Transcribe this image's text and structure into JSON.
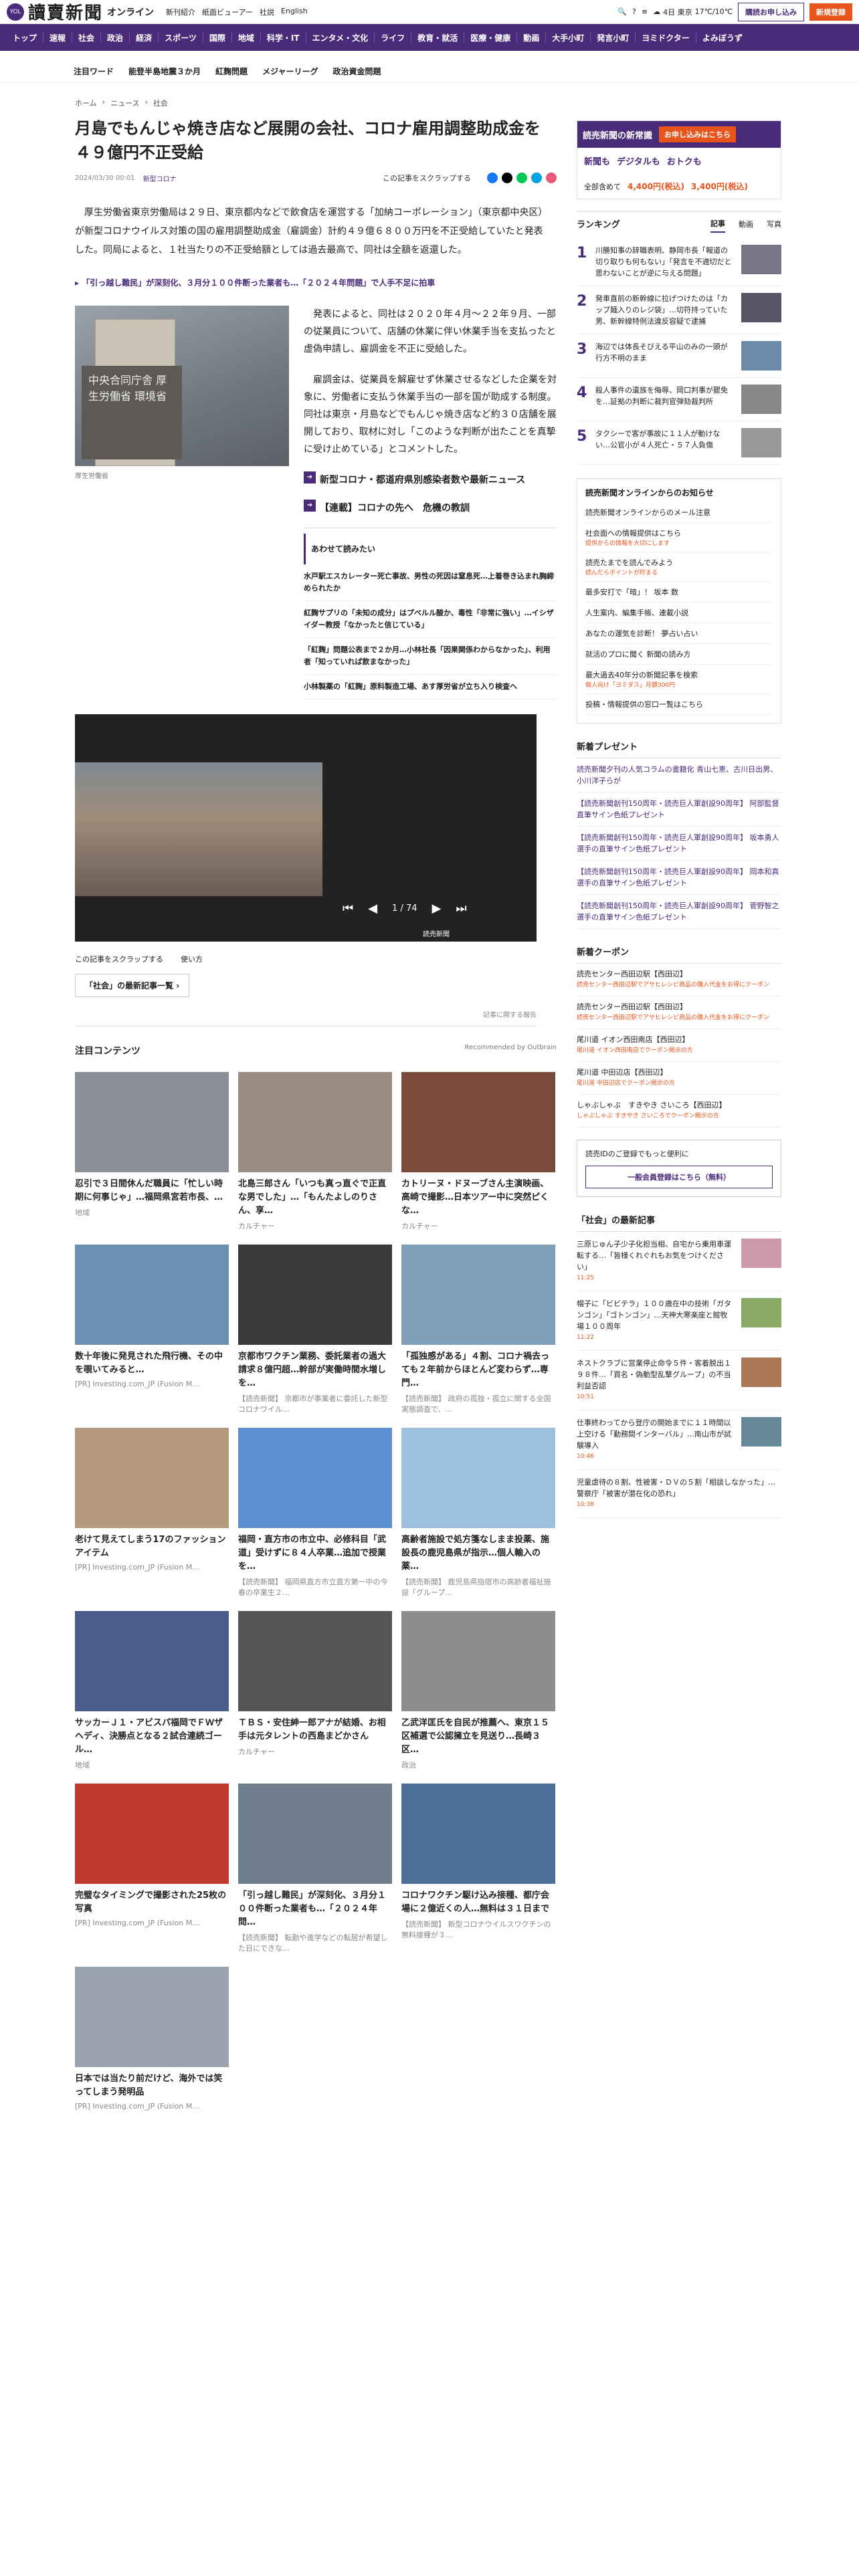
{
  "header": {
    "yol_badge": "YOL",
    "logo_text": "讀賣新聞",
    "logo_suffix": "オンライン",
    "top_links": [
      "新刊紹介",
      "紙面ビューアー",
      "社説",
      "English"
    ],
    "weather_text": "4日 東京",
    "weather_temp": "17℃/10℃",
    "login_label": "購読お申し込み",
    "register_label": "新規登録",
    "nav": [
      "トップ",
      "速報",
      "社会",
      "政治",
      "経済",
      "スポーツ",
      "国際",
      "地域",
      "科学・IT",
      "エンタメ・文化",
      "ライフ",
      "教育・就活",
      "医療・健康",
      "動画",
      "大手小町",
      "発言小町",
      "ヨミドクター",
      "よみぼうず"
    ],
    "hot_label": "注目ワード",
    "hot_items": [
      "能登半島地震３か月",
      "紅麹問題",
      "メジャーリーグ",
      "政治資金問題"
    ]
  },
  "breadcrumb": [
    "ホーム",
    "ニュース",
    "社会"
  ],
  "article": {
    "title": "月島でもんじゃ焼き店など展開の会社、コロナ雇用調整助成金を４９億円不正受給",
    "date": "2024/03/30 00:01",
    "tag": "新型コロナ",
    "scrap_label": "この記事をスクラップする",
    "lead": "厚生労働省東京労働局は２９日、東京都内などで飲食店を運営する「加納コーポレーション」（東京都中央区）が新型コロナウイルス対策の国の雇用調整助成金（雇調金）計約４９億６８００万円を不正受給していたと発表した。同局によると、１社当たりの不正受給額としては過去最高で、同社は全額を返還した。",
    "related_link": "「引っ越し難民」が深刻化、３月分１００件断った業者も…「２０２４年問題」で人手不足に拍車",
    "photo_sign": "中央合同庁舎 厚生労働省 環境省",
    "photo_caption": "厚生労働省",
    "para1": "発表によると、同社は２０２０年４月～２２年９月、一部の従業員について、店舗の休業に伴い休業手当を支払ったと虚偽申請し、雇調金を不正に受給した。",
    "para2": "雇調金は、従業員を解雇せず休業させるなどした企業を対象に、労働者に支払う休業手当の一部を国が助成する制度。同社は東京・月島などでもんじゃ焼き店など約３０店舗を展開しており、取材に対し「このような判断が出たことを真摯に受け止めている」とコメントした。",
    "tool1": "新型コロナ・都道府県別感染者数や最新ニュース",
    "tool2": "【連載】コロナの先へ　危機の教訓"
  },
  "alsoread": {
    "title": "あわせて読みたい",
    "items": [
      "水戸駅エスカレーター死亡事故、男性の死因は窒息死…上着巻き込まれ胸締められたか",
      "紅麹サプリの「未知の成分」はプベルル酸か、毒性「非常に強い」…イシザイダー教授「なかったと信じている」",
      "「紅麹」問題公表まで２か月…小林社長「因果関係わからなかった」、利用者「知っていれば飲まなかった」",
      "小林製薬の「紅麹」原料製造工場、あす厚労省が立ち入り検査へ"
    ]
  },
  "gallery": {
    "counter": "1 / 74",
    "overlay": "読売新聞"
  },
  "below": {
    "scrap": "この記事をスクラップする",
    "howto": "使い方",
    "latest": "「社会」の最新記事一覧",
    "report": "記事に関する報告"
  },
  "attention": {
    "title": "注目コンテンツ",
    "recommended": "Recommended by Outbrain"
  },
  "cards": [
    {
      "title": "忍引で３日間休んだ職員に「忙しい時期に何事じゃ」…福岡県宮若市長、…",
      "src": "地域"
    },
    {
      "title": "北島三郎さん「いつも真っ直ぐで正直な男でした」…「もんたよしのりさん、享…",
      "src": "カルチャー"
    },
    {
      "title": "カトリーヌ・ドヌーブさん主演映画、高崎で撮影…日本ツアー中に突然ピくな…",
      "src": "カルチャー"
    },
    {
      "title": "数十年後に発見された飛行機、その中を覗いてみると…",
      "src": "[PR] Investing.com_JP (Fusion M…"
    },
    {
      "title": "京都市ワクチン業務、委託業者の過大請求８億円超…幹部が実働時間水増しを…",
      "src": "【読売新聞】 京都市が事業者に委託した新型コロナワイル…"
    },
    {
      "title": "「孤独感がある」４割、コロナ禍去っても２年前からほとんど変わらず…専門…",
      "src": "【読売新聞】 政府の孤独・孤立に関する全国実態調査で、…"
    },
    {
      "title": "老けて見えてしまう17のファッションアイテム",
      "src": "[PR] Investing.com_JP (Fusion M…"
    },
    {
      "title": "福岡・直方市の市立中、必修科目「武道」受けずに８４人卒業…追加で授業を…",
      "src": "【読売新聞】 福岡県直方市立直方第一中の今春の卒業生２…"
    },
    {
      "title": "高齢者施設で処方箋なしまま投薬、施設長の鹿児島県が指示…個人輸入の薬…",
      "src": "【読売新聞】 鹿児島県指宿市の高齢者福祉施設「グループ…"
    },
    {
      "title": "サッカーＪ１・アビスパ福岡でＦＷザヘディ、決勝点となる２試合連続ゴール…",
      "src": "地域"
    },
    {
      "title": "ＴＢＳ・安住紳一郎アナが結婚、お相手は元タレントの西島まどかさん",
      "src": "カルチャー"
    },
    {
      "title": "乙武洋匡氏を自民が推薦へ、東京１５区補選で公認擁立を見送り…長崎３区…",
      "src": "政治"
    },
    {
      "title": "完璧なタイミングで撮影された25枚の写真",
      "src": "[PR] Investing.com_JP (Fusion M…"
    },
    {
      "title": "「引っ越し難民」が深刻化、３月分１００件断った業者も…「２０２４年問…",
      "src": "【読売新聞】 転勤や進学などの転居が希望した日にできな…"
    },
    {
      "title": "コロナワクチン駆け込み接種、都庁会場に２億近くの人…無料は３１日まで",
      "src": "【読売新聞】 新型コロナウイルスワクチンの無料接種が３…"
    },
    {
      "title": "日本では当たり前だけど、海外では笑ってしまう発明品",
      "src": "[PR] Investing.com_JP (Fusion M…"
    }
  ],
  "sidebar": {
    "promo_title": "読売新聞の新常識",
    "promo_cta": "お申し込みはこちら",
    "promo_a": "新聞も",
    "promo_b": "デジタルも",
    "promo_c": "おトクも",
    "promo_all": "全部含めて",
    "promo_price1": "4,400円(税込)",
    "promo_price2": "3,400円(税込)",
    "ranking_title": "ランキング",
    "ranking_tabs": [
      "記事",
      "動画",
      "写真"
    ],
    "ranking": [
      "川勝知事の辞職表明、静岡市長「報道の切り取りも何もない」「発言を不適切だと思わないことが逆に与える問題」",
      "発車直前の新幹線に拉げつけたのは「カップ麺入りのレジ袋」…切符持っていた男、新幹線特例法違反容疑で逮捕",
      "海辺では体長そびえる平山のみの一頭が行方不明のまま",
      "殺人事件の遺族を侮辱、岡口判事が罷免を…証拠の判断に裁判官弾劾裁判所",
      "タクシーで客が事故に１１人が動けない…公官小が４人死亡・５７人負傷"
    ],
    "info_title": "読売新聞オンラインからのお知らせ",
    "info": [
      {
        "t": "読売新聞オンラインからのメール注意",
        "s": ""
      },
      {
        "t": "社会面への情報提供はこちら",
        "s": "提供からの情報を大切にします"
      },
      {
        "t": "読売たまでを読んでみよう",
        "s": "読んだらポイントが貯まる"
      },
      {
        "t": "最多安打で「暗」！ 坂本 数",
        "s": ""
      },
      {
        "t": "人生案内、編集手帳、連載小説",
        "s": ""
      },
      {
        "t": "あなたの運気を診断！ 夢占い占い",
        "s": ""
      },
      {
        "t": "就活のプロに聞く 新聞の読み方",
        "s": ""
      },
      {
        "t": "最大過去40年分の新聞記事を検索",
        "s": "個人向け「ヨミダス」月額300円"
      },
      {
        "t": "投稿・情報提供の窓口一覧はこちら",
        "s": ""
      }
    ],
    "present_title": "新着プレゼント",
    "presents": [
      "読売新聞夕刊の人気コラムの書籍化 青山七恵、古川日出男、小川洋子らが",
      "【読売新聞創刊150周年・読売巨人軍創設90周年】 阿部監督直筆サイン色紙プレゼント",
      "【読売新聞創刊150周年・読売巨人軍創設90周年】 坂本勇人選手の直筆サイン色紙プレゼント",
      "【読売新聞創刊150周年・読売巨人軍創設90周年】 岡本和真選手の直筆サイン色紙プレゼント",
      "【読売新聞創刊150周年・読売巨人軍創設90周年】 菅野智之選手の直筆サイン色紙プレゼント"
    ],
    "coupon_title": "新着クーポン",
    "coupons": [
      {
        "t": "読売センター西田辺駅【西田辺】",
        "s": "読売センター西田辺駅でアサヒレシピ商品の購入代金をお得にクーポン"
      },
      {
        "t": "読売センター西田辺駅【西田辺】",
        "s": "読売センター西田辺駅でアサヒレシピ商品の購入代金をお得にクーポン"
      },
      {
        "t": "尾川道 イオン西田南店【西田辺】",
        "s": "尾川道 イオン西田南店でクーポン掲示の方"
      },
      {
        "t": "尾川道 中田辺店【西田辺】",
        "s": "尾川道 中田辺店でクーポン掲示の方"
      },
      {
        "t": "しゃぶしゃぶ　すきやき さいころ【西田辺】",
        "s": "しゃぶしゃぶ すきやき さいころでクーポン掲示の方"
      }
    ],
    "id_text": "読売IDのご登録でもっと便利に",
    "id_btn": "一般会員登録はこちら（無料）",
    "latest_title": "「社会」の最新記事",
    "latest": [
      {
        "t": "三原じゅん子少子化担当相、自宅から乗用車運転する…「皆様くれぐれもお気をつけください」",
        "tm": "11:25"
      },
      {
        "t": "帽子に「ビビテラ」１００歳在中の技術「ガタンゴン」「ゴトンゴン」…天神大寒楽座と館牧場１００周年",
        "tm": "11:22"
      },
      {
        "t": "ネストクラブに営業停止命令５件・客着脱出１９８件…「買名・偽動型乱撃グループ」の不当利益否認",
        "tm": "10:51"
      },
      {
        "t": "仕事終わってから登庁の開始までに１１時間以上空ける「勤務間インターバル」…南山市が試験導入",
        "tm": "10:46"
      },
      {
        "t": "児童虐待の８割、性被害・ＤＶの５割「相談しなかった」…警察庁「被害が潜在化の恐れ」",
        "tm": "10:38"
      }
    ]
  }
}
